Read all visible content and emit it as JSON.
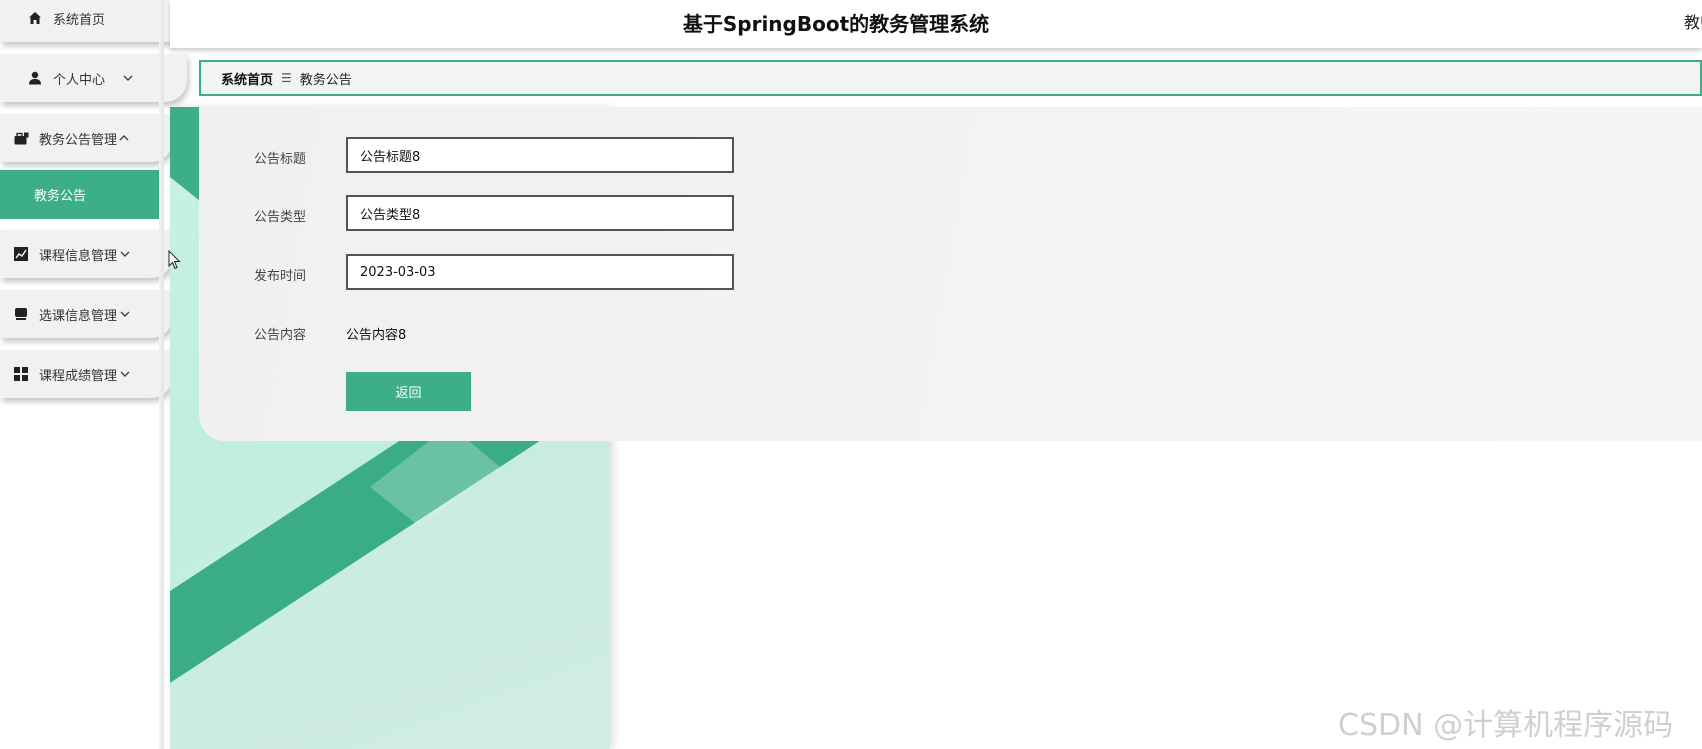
{
  "header": {
    "title": "基于SpringBoot的教务管理系统",
    "user_text": "教师"
  },
  "sidebar": {
    "items": [
      {
        "label": "系统首页",
        "icon": "home-icon"
      },
      {
        "label": "个人中心",
        "icon": "user-icon"
      },
      {
        "label": "教务公告管理",
        "icon": "briefcase-icon"
      },
      {
        "label": "课程信息管理",
        "icon": "chart-icon"
      },
      {
        "label": "选课信息管理",
        "icon": "inbox-icon"
      },
      {
        "label": "课程成绩管理",
        "icon": "grid-icon"
      }
    ],
    "active_sub": "教务公告"
  },
  "breadcrumb": {
    "home": "系统首页",
    "separator": "☰",
    "current": "教务公告"
  },
  "form": {
    "title_label": "公告标题",
    "title_value": "公告标题8",
    "type_label": "公告类型",
    "type_value": "公告类型8",
    "time_label": "发布时间",
    "time_value": "2023-03-03",
    "content_label": "公告内容",
    "content_value": "公告内容8",
    "back_label": "返回"
  },
  "watermark": "CSDN @计算机程序源码",
  "colors": {
    "accent": "#3daf86",
    "menu_bg": "#f1f1f1",
    "card_bg": "#f3f2f2"
  }
}
